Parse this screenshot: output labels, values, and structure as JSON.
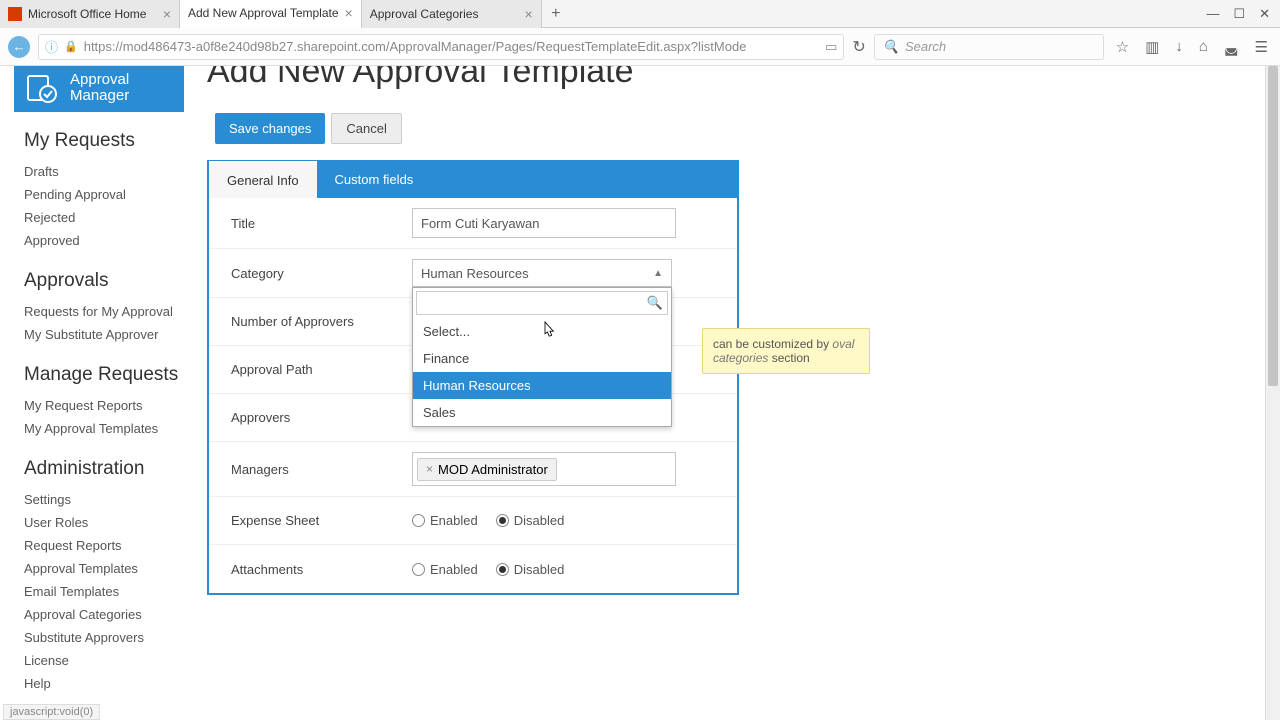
{
  "tabs": [
    {
      "label": "Microsoft Office Home",
      "active": false
    },
    {
      "label": "Add New Approval Template",
      "active": true
    },
    {
      "label": "Approval Categories",
      "active": false
    }
  ],
  "url": "https://mod486473-a0f8e240d98b27.sharepoint.com/ApprovalManager/Pages/RequestTemplateEdit.aspx?listMode",
  "search_placeholder": "Search",
  "app_logo": {
    "line1": "Approval",
    "line2": "Manager"
  },
  "sidebar": {
    "s1": {
      "head": "My Requests",
      "items": [
        "Drafts",
        "Pending Approval",
        "Rejected",
        "Approved"
      ]
    },
    "s2": {
      "head": "Approvals",
      "items": [
        "Requests for My Approval",
        "My Substitute Approver"
      ]
    },
    "s3": {
      "head": "Manage Requests",
      "items": [
        "My Request Reports",
        "My Approval Templates"
      ]
    },
    "s4": {
      "head": "Administration",
      "items": [
        "Settings",
        "User Roles",
        "Request Reports",
        "Approval Templates",
        "Email Templates",
        "Approval Categories",
        "Substitute Approvers",
        "License",
        "Help"
      ]
    }
  },
  "page_title": "Add New Approval Template",
  "buttons": {
    "save": "Save changes",
    "cancel": "Cancel"
  },
  "form_tabs": {
    "general": "General Info",
    "custom": "Custom fields"
  },
  "labels": {
    "title": "Title",
    "category": "Category",
    "num_approvers": "Number of Approvers",
    "approval_path": "Approval Path",
    "approvers": "Approvers",
    "managers": "Managers",
    "expense": "Expense Sheet",
    "attachments": "Attachments"
  },
  "fields": {
    "title_value": "Form Cuti Karyawan",
    "category_selected": "Human Resources",
    "category_options": [
      "Select...",
      "Finance",
      "Human Resources",
      "Sales"
    ],
    "manager_token": "MOD Administrator"
  },
  "radio": {
    "enabled": "Enabled",
    "disabled": "Disabled"
  },
  "tooltip_text1": "can be customized by",
  "tooltip_text2": "oval categories",
  "tooltip_text3": " section",
  "status": "javascript:void(0)"
}
